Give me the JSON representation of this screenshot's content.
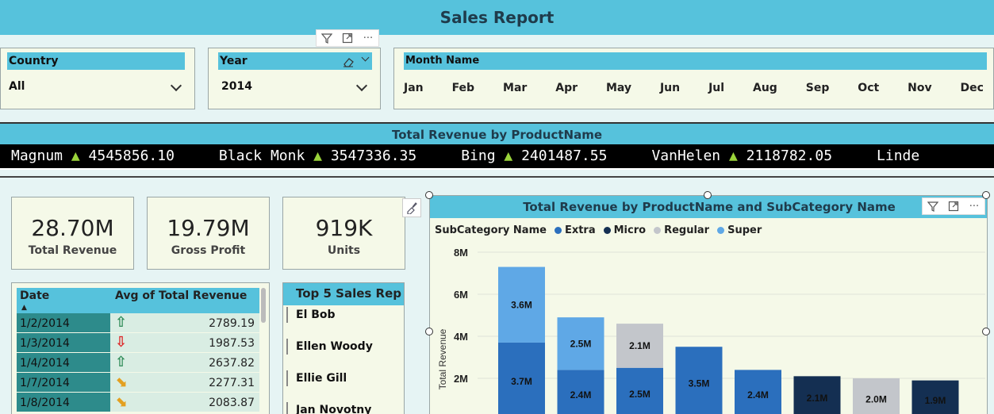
{
  "report": {
    "title": "Sales Report"
  },
  "slicers": {
    "country": {
      "label": "Country",
      "value": "All"
    },
    "year": {
      "label": "Year",
      "value": "2014"
    },
    "month": {
      "label": "Month Name",
      "months": [
        "Jan",
        "Feb",
        "Mar",
        "Apr",
        "May",
        "Jun",
        "Jul",
        "Aug",
        "Sep",
        "Oct",
        "Nov",
        "Dec"
      ]
    }
  },
  "ticker": {
    "title": "Total Revenue by ProductName",
    "items": [
      {
        "name": "Magnum",
        "value": "4545856.10"
      },
      {
        "name": "Black Monk",
        "value": "3547336.35"
      },
      {
        "name": "Bing",
        "value": "2401487.55"
      },
      {
        "name": "VanHelen",
        "value": "2118782.05"
      },
      {
        "name": "Linde",
        "value": ""
      }
    ]
  },
  "cards": [
    {
      "value": "28.70M",
      "label": "Total Revenue"
    },
    {
      "value": "19.79M",
      "label": "Gross Profit"
    },
    {
      "value": "919K",
      "label": "Units"
    }
  ],
  "table": {
    "headers": {
      "date": "Date",
      "avg": "Avg of Total Revenue"
    },
    "rows": [
      {
        "date": "1/2/2014",
        "avg": "2789.19",
        "trend": "up"
      },
      {
        "date": "1/3/2014",
        "avg": "1987.53",
        "trend": "down"
      },
      {
        "date": "1/4/2014",
        "avg": "2637.82",
        "trend": "up"
      },
      {
        "date": "1/7/2014",
        "avg": "2277.31",
        "trend": "diag"
      },
      {
        "date": "1/8/2014",
        "avg": "2083.87",
        "trend": "diag"
      }
    ]
  },
  "sales_reps": {
    "title": "Top 5 Sales Rep",
    "items": [
      "El Bob",
      "Ellen Woody",
      "Ellie Gill",
      "Jan Novotny"
    ]
  },
  "colors": {
    "extra": "#2b6fbd",
    "micro": "#142f52",
    "regular": "#c3c6cb",
    "super": "#5fa8e6",
    "accent": "#56c2dc"
  },
  "chart_data": {
    "type": "bar",
    "title": "Total Revenue by ProductName and SubCategory Name",
    "legend_title": "SubCategory Name",
    "legend": [
      "Extra",
      "Micro",
      "Regular",
      "Super"
    ],
    "ylabel": "Total Revenue",
    "ylim": [
      0,
      8000000
    ],
    "yticks": [
      "8M",
      "6M",
      "4M",
      "2M"
    ],
    "ytick_values": [
      8000000,
      6000000,
      4000000,
      2000000
    ],
    "bars": [
      {
        "segments": [
          {
            "series": "Extra",
            "value": 3700000,
            "label": "3.7M"
          },
          {
            "series": "Super",
            "value": 3600000,
            "label": "3.6M"
          }
        ]
      },
      {
        "segments": [
          {
            "series": "Extra",
            "value": 2400000,
            "label": "2.4M"
          },
          {
            "series": "Super",
            "value": 2500000,
            "label": "2.5M"
          }
        ]
      },
      {
        "segments": [
          {
            "series": "Extra",
            "value": 2500000,
            "label": "2.5M"
          },
          {
            "series": "Regular",
            "value": 2100000,
            "label": "2.1M"
          }
        ]
      },
      {
        "segments": [
          {
            "series": "Extra",
            "value": 3500000,
            "label": "3.5M"
          }
        ]
      },
      {
        "segments": [
          {
            "series": "Extra",
            "value": 2400000,
            "label": "2.4M"
          }
        ]
      },
      {
        "segments": [
          {
            "series": "Micro",
            "value": 2100000,
            "label": "2.1M"
          }
        ]
      },
      {
        "segments": [
          {
            "series": "Regular",
            "value": 2000000,
            "label": "2.0M"
          }
        ]
      },
      {
        "segments": [
          {
            "series": "Micro",
            "value": 1900000,
            "label": "1.9M"
          }
        ]
      }
    ]
  }
}
